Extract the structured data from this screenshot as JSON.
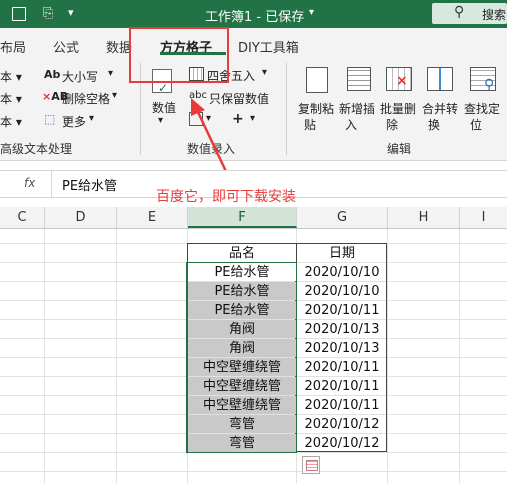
{
  "title_bar": {
    "doc_title": "工作簿1 - 已保存",
    "search_label": "搜索"
  },
  "tabs": [
    "布局",
    "公式",
    "数据",
    "方方格子",
    "DIY工具箱"
  ],
  "active_tab": "方方格子",
  "ribbon": {
    "text_group": {
      "items": [
        "大小写",
        "删除空格",
        "更多"
      ],
      "label": "高级文本处理"
    },
    "value_group": {
      "numeric": "数值",
      "round": "四舍五入",
      "keep_values": "只保留数值",
      "label": "数值录入"
    },
    "edit_group": {
      "buttons": [
        [
          "复制粘",
          "贴"
        ],
        [
          "新增插",
          "入"
        ],
        [
          "批量删",
          "除"
        ],
        [
          "合并转",
          "换"
        ],
        [
          "查找定",
          "位"
        ]
      ],
      "label": "编辑"
    }
  },
  "formula_bar": {
    "fx": "fx",
    "value": "PE给水管"
  },
  "annotation": "百度它，即可下载安装",
  "columns": [
    "C",
    "D",
    "E",
    "F",
    "G",
    "H",
    "I"
  ],
  "selected_column": "F",
  "table": {
    "headers": [
      "品名",
      "日期"
    ],
    "rows": [
      [
        "PE给水管",
        "2020/10/10"
      ],
      [
        "PE给水管",
        "2020/10/10"
      ],
      [
        "PE给水管",
        "2020/10/11"
      ],
      [
        "角阀",
        "2020/10/13"
      ],
      [
        "角阀",
        "2020/10/13"
      ],
      [
        "中空壁缠绕管",
        "2020/10/11"
      ],
      [
        "中空壁缠绕管",
        "2020/10/11"
      ],
      [
        "中空壁缠绕管",
        "2020/10/11"
      ],
      [
        "弯管",
        "2020/10/12"
      ],
      [
        "弯管",
        "2020/10/12"
      ]
    ]
  },
  "colors": {
    "accent": "#217346",
    "annotation": "#e83b3b",
    "selection_fill": "#c9c9c9"
  }
}
